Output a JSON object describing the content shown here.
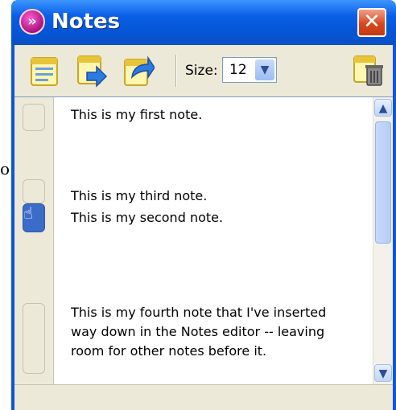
{
  "window": {
    "title": "Notes"
  },
  "toolbar": {
    "icons": [
      "new-note-icon",
      "import-icon",
      "export-icon",
      "trash-icon"
    ],
    "size_label": "Size:",
    "size_value": "12"
  },
  "notes": [
    {
      "text": "This is my first note."
    },
    {
      "text": "This is my third note."
    },
    {
      "text": "This is my second note."
    },
    {
      "text": "This is my fourth note that I've inserted\nway down in the Notes editor -- leaving\nroom for other notes before it."
    }
  ],
  "left_fragment": "o",
  "colors": {
    "titlebar": "#0a5fe6",
    "panel": "#ece9d8",
    "active_slot": "#3a6cc8"
  }
}
